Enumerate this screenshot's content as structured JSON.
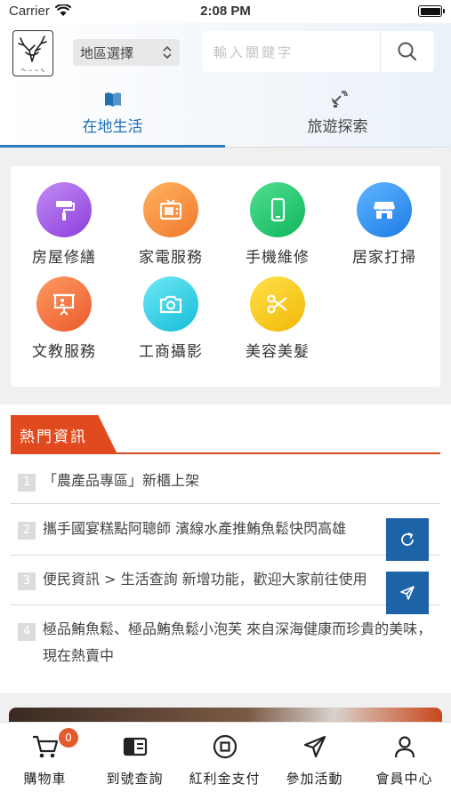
{
  "status_bar": {
    "carrier": "Carrier",
    "time": "2:08 PM"
  },
  "header": {
    "region_select": {
      "label": "地區選擇"
    },
    "search": {
      "placeholder": "輸入關鍵字"
    },
    "tabs": [
      {
        "label": "在地生活",
        "icon": "book-icon",
        "active": true
      },
      {
        "label": "旅遊探索",
        "icon": "satellite-icon",
        "active": false
      }
    ]
  },
  "services": [
    {
      "label": "房屋修繕",
      "icon": "paint-roller-icon",
      "color": "#9b4fe0"
    },
    {
      "label": "家電服務",
      "icon": "tv-icon",
      "color": "#f58a3c"
    },
    {
      "label": "手機維修",
      "icon": "phone-icon",
      "color": "#19c46a"
    },
    {
      "label": "居家打掃",
      "icon": "store-icon",
      "color": "#2d8cf0"
    },
    {
      "label": "文教服務",
      "icon": "presentation-icon",
      "color": "#f06a3a"
    },
    {
      "label": "工商攝影",
      "icon": "camera-icon",
      "color": "#22c6e0"
    },
    {
      "label": "美容美髮",
      "icon": "scissors-icon",
      "color": "#f5c518"
    }
  ],
  "news": {
    "title": "熱門資訊",
    "accent": "#e04a1e",
    "items": [
      {
        "num": "1",
        "text": "「農產品專區」新櫃上架"
      },
      {
        "num": "2",
        "text": "攜手國宴糕點阿聰師 濱線水產推鮪魚鬆快閃高雄"
      },
      {
        "num": "3",
        "text": "便民資訊 > 生活查詢 新增功能，歡迎大家前往使用"
      },
      {
        "num": "4",
        "text": "極品鮪魚鬆、極品鮪魚鬆小泡芙 來自深海健康而珍貴的美味，現在熱賣中"
      }
    ]
  },
  "floating_buttons": [
    {
      "icon": "refresh-icon"
    },
    {
      "icon": "send-icon"
    }
  ],
  "tab_bar": {
    "items": [
      {
        "label": "購物車",
        "icon": "cart-icon",
        "badge": "0"
      },
      {
        "label": "到號查詢",
        "icon": "book-open-icon"
      },
      {
        "label": "紅利金支付",
        "icon": "coin-icon"
      },
      {
        "label": "參加活動",
        "icon": "send-icon"
      },
      {
        "label": "會員中心",
        "icon": "user-icon"
      }
    ]
  }
}
